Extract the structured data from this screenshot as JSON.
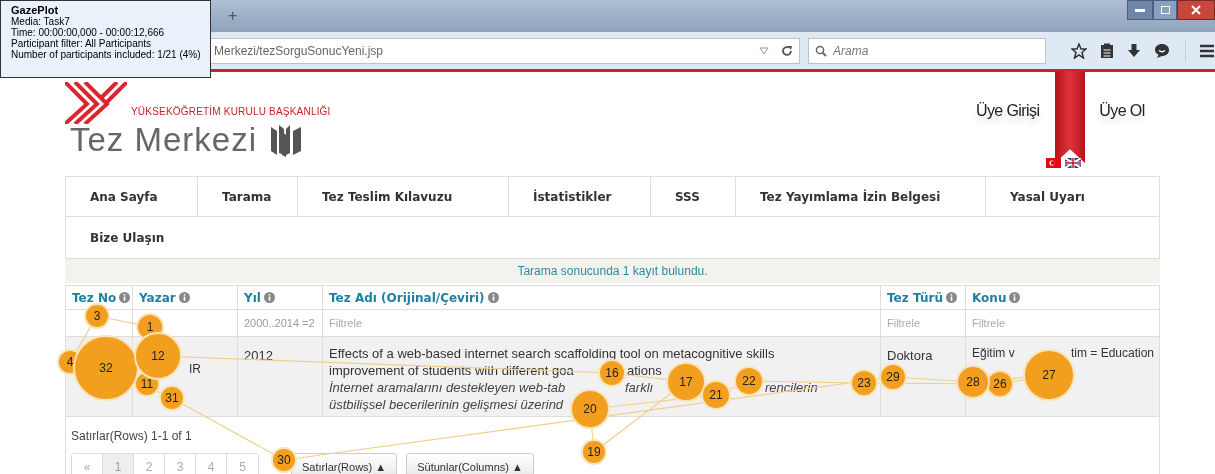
{
  "gaze_plot": {
    "title": "GazePlot",
    "lines": [
      "Media: Task7",
      "Time: 00:00:00,000 - 00:00:12,666",
      "Participant filter: All Participants",
      "Number of participants included: 1/21 (4%)"
    ]
  },
  "browser": {
    "new_tab": "+",
    "url": "Merkezi/tezSorguSonucYeni.jsp",
    "search": {
      "placeholder": "Arama"
    }
  },
  "header": {
    "org": "YÜKSEKÖĞRETİM KURULU BAŞKANLIĞI",
    "title": "Tez Merkezi",
    "links": [
      "Üye Girişi",
      "Üye Ol"
    ]
  },
  "nav": [
    {
      "label": "Ana Sayfa"
    },
    {
      "label": "Tarama"
    },
    {
      "label": "Tez Teslim Kılavuzu"
    },
    {
      "label": "İstatistikler"
    },
    {
      "label": "SSS"
    },
    {
      "label": "Tez Yayımlama İzin Belgesi"
    },
    {
      "label": "Yasal Uyarı"
    },
    {
      "label": "Bize Ulaşın"
    }
  ],
  "result_message": "Tarama sonucunda 1 kayıt bulundu.",
  "table": {
    "columns": [
      {
        "label": "Tez No"
      },
      {
        "label": "Yazar"
      },
      {
        "label": "Yıl",
        "filter_value": "2000..2014 =2"
      },
      {
        "label": "Tez Adı (Orijinal/Çeviri)",
        "filter_placeholder": "Filtrele"
      },
      {
        "label": "Tez Türü",
        "filter_placeholder": "Filtrele"
      },
      {
        "label": "Konu",
        "filter_placeholder": "Filtrele"
      }
    ],
    "row": {
      "author_fragments": [
        "IR"
      ],
      "year": "2012",
      "title_lines": [
        {
          "kind": "original",
          "fragments": [
            "Effects of a web-based internet search scaffolding tool on metacognitive skills"
          ]
        },
        {
          "kind": "original",
          "fragments": [
            "improvement of students with different goa",
            "ations"
          ]
        },
        {
          "kind": "translation",
          "fragments": [
            "İnternet aramalarını destekleyen web-tab",
            "farklı",
            "rencilerin"
          ]
        },
        {
          "kind": "translation",
          "fragments": [
            "üstbilişsel becerilerinin gelişmesi üzerind"
          ]
        }
      ],
      "type": "Doktora",
      "subject_fragments": [
        "Eğitim v",
        "tim = Education"
      ]
    }
  },
  "footer": {
    "row_count": "Satırlar(Rows) 1-1 of 1",
    "pages": [
      {
        "label": "«",
        "selected": false
      },
      {
        "label": "1",
        "selected": true
      },
      {
        "label": "2",
        "selected": false
      },
      {
        "label": "3",
        "selected": false
      },
      {
        "label": "4",
        "selected": false
      },
      {
        "label": "5",
        "selected": false
      }
    ],
    "buttons": [
      "Satırlar(Rows) ▲",
      "Sütunlar(Columns) ▲"
    ]
  },
  "gaze_points": [
    {
      "label": "4"
    },
    {
      "label": "32"
    },
    {
      "label": "3"
    },
    {
      "label": "11"
    },
    {
      "label": "12"
    },
    {
      "label": "1"
    },
    {
      "label": "31"
    },
    {
      "label": "30"
    },
    {
      "label": "20"
    },
    {
      "label": "19"
    },
    {
      "label": "16"
    },
    {
      "label": "17"
    },
    {
      "label": "21"
    },
    {
      "label": "22"
    },
    {
      "label": "23"
    },
    {
      "label": "29"
    },
    {
      "label": "28"
    },
    {
      "label": "26"
    },
    {
      "label": "27"
    }
  ]
}
